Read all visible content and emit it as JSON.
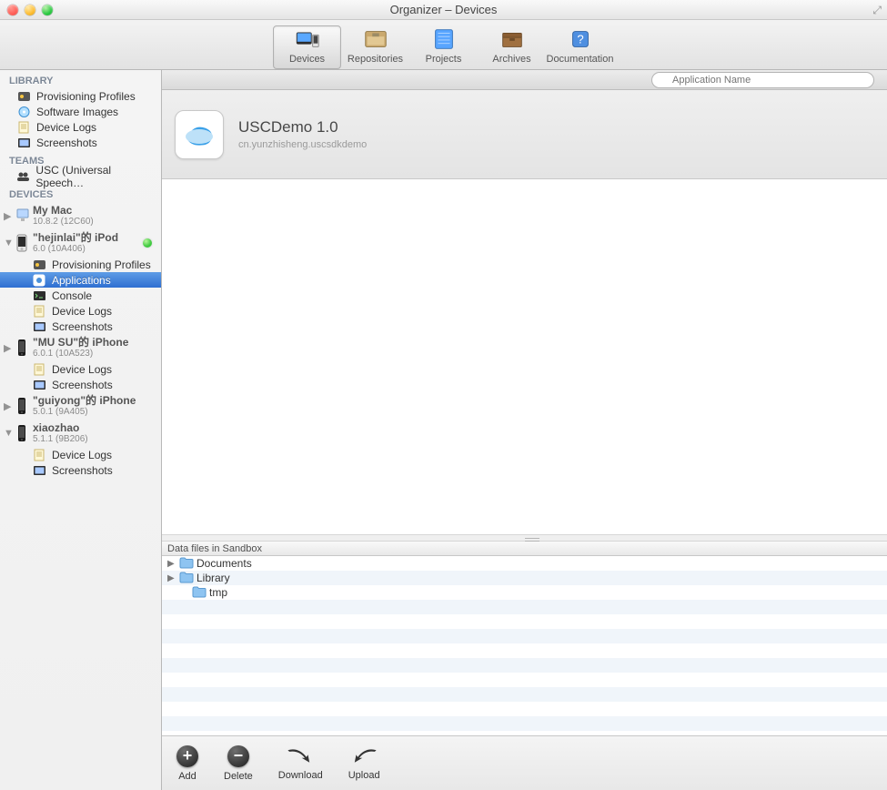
{
  "window": {
    "title": "Organizer – Devices"
  },
  "toolbar": {
    "devices": "Devices",
    "repositories": "Repositories",
    "projects": "Projects",
    "archives": "Archives",
    "documentation": "Documentation"
  },
  "search": {
    "placeholder": "Application Name"
  },
  "sidebar": {
    "library_head": "LIBRARY",
    "library": [
      {
        "label": "Provisioning Profiles",
        "icon": "badge"
      },
      {
        "label": "Software Images",
        "icon": "disc"
      },
      {
        "label": "Device Logs",
        "icon": "log"
      },
      {
        "label": "Screenshots",
        "icon": "shot"
      }
    ],
    "teams_head": "TEAMS",
    "teams": [
      {
        "label": "USC (Universal Speech…",
        "icon": "team"
      }
    ],
    "devices_head": "DEVICES",
    "devices": [
      {
        "name": "My Mac",
        "ver": "10.8.2 (12C60)",
        "icon": "mac",
        "disc": "▶",
        "status": false,
        "children": []
      },
      {
        "name": "\"hejinlai\"的 iPod",
        "ver": "6.0 (10A406)",
        "icon": "ipod",
        "disc": "▼",
        "status": true,
        "children": [
          {
            "label": "Provisioning Profiles",
            "icon": "badge"
          },
          {
            "label": "Applications",
            "icon": "app",
            "selected": true
          },
          {
            "label": "Console",
            "icon": "console"
          },
          {
            "label": "Device Logs",
            "icon": "log"
          },
          {
            "label": "Screenshots",
            "icon": "shot"
          }
        ]
      },
      {
        "name": "\"MU SU\"的 iPhone",
        "ver": "6.0.1 (10A523)",
        "icon": "iphone",
        "disc": "▶",
        "status": false,
        "children": [
          {
            "label": "Device Logs",
            "icon": "log"
          },
          {
            "label": "Screenshots",
            "icon": "shot"
          }
        ]
      },
      {
        "name": "\"guiyong\"的 iPhone",
        "ver": "5.0.1 (9A405)",
        "icon": "iphone",
        "disc": "▶",
        "status": false,
        "children": []
      },
      {
        "name": "xiaozhao",
        "ver": "5.1.1 (9B206)",
        "icon": "iphone",
        "disc": "▼",
        "status": false,
        "children": [
          {
            "label": "Device Logs",
            "icon": "log"
          },
          {
            "label": "Screenshots",
            "icon": "shot"
          }
        ]
      }
    ]
  },
  "app": {
    "name": "USCDemo 1.0",
    "bundle": "cn.yunzhisheng.uscsdkdemo"
  },
  "sandbox": {
    "title": "Data files in Sandbox",
    "rows": [
      {
        "label": "Documents",
        "disc": "▶",
        "indent": 0
      },
      {
        "label": "Library",
        "disc": "▶",
        "indent": 0
      },
      {
        "label": "tmp",
        "disc": "",
        "indent": 1
      }
    ]
  },
  "bottom": {
    "add": "Add",
    "delete": "Delete",
    "download": "Download",
    "upload": "Upload"
  }
}
